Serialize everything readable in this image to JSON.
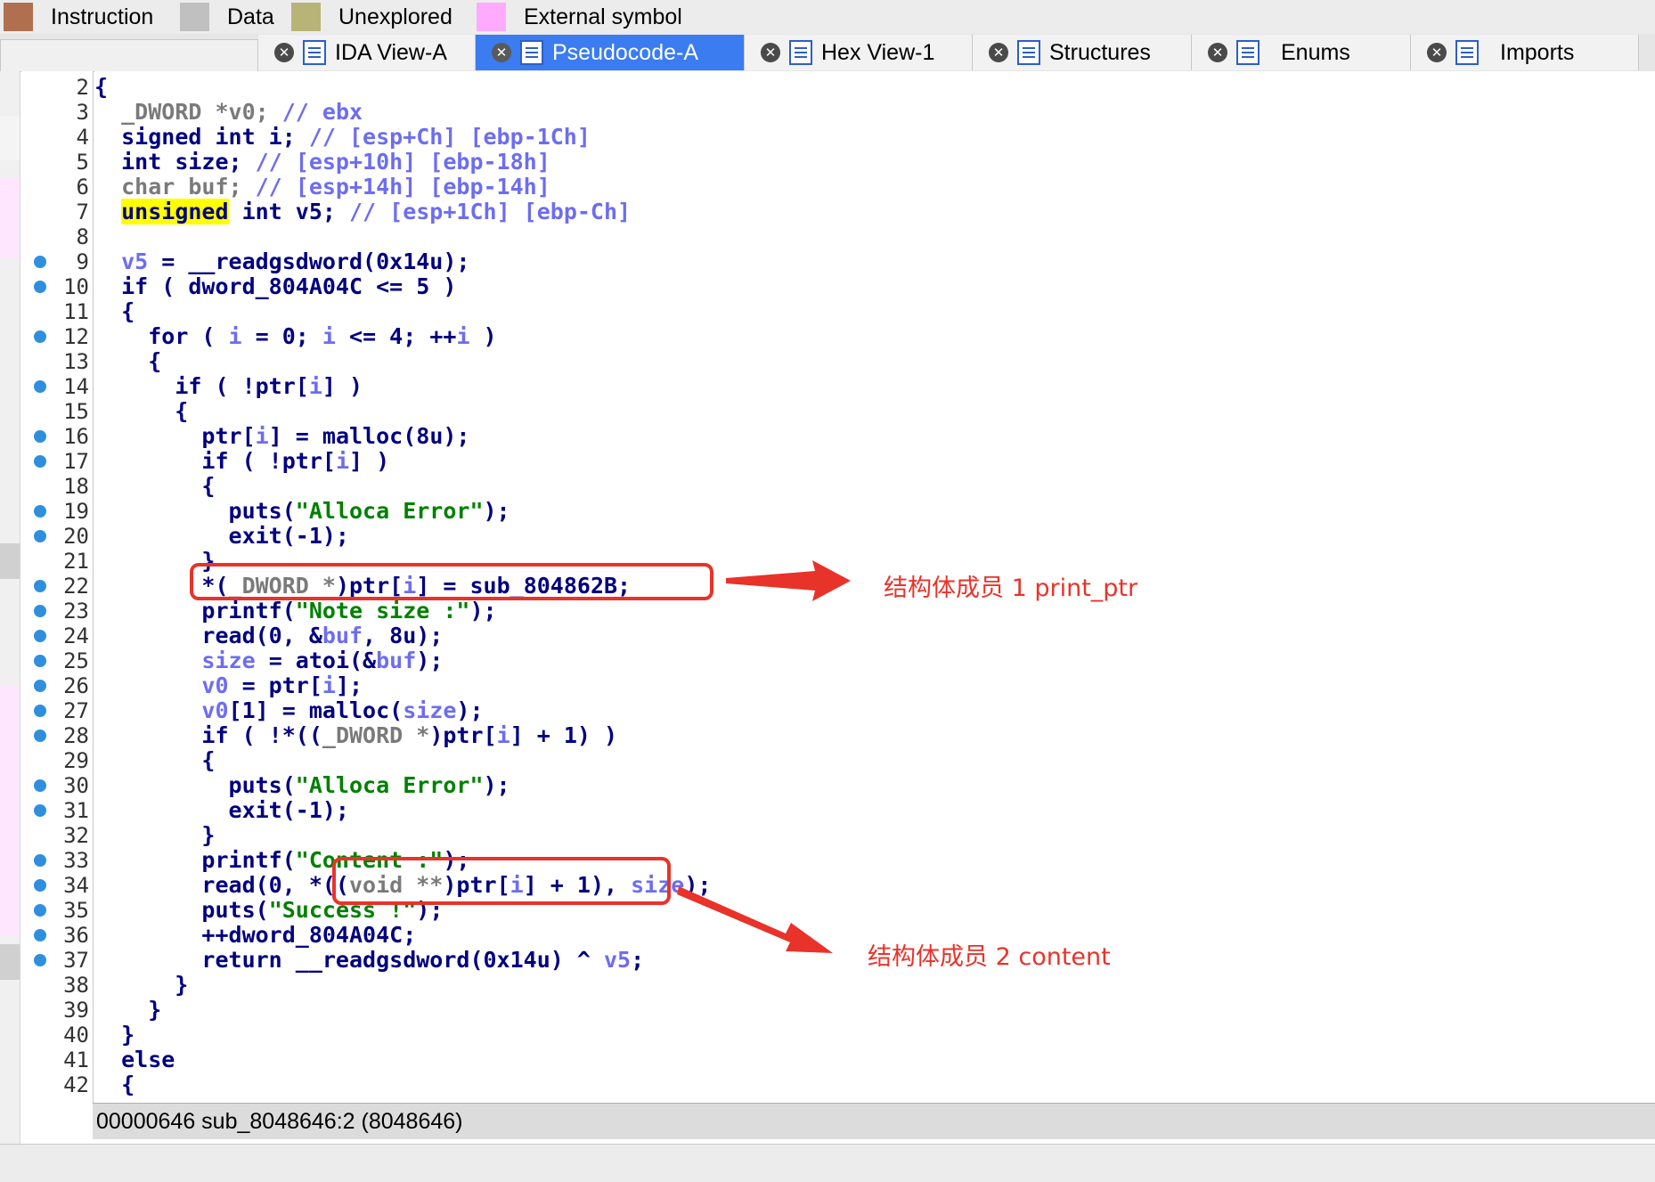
{
  "legend": [
    {
      "label": "Instruction",
      "color": "#b07050"
    },
    {
      "label": "Data",
      "color": "#c0c0c0"
    },
    {
      "label": "Unexplored",
      "color": "#b8b478"
    },
    {
      "label": "External symbol",
      "color": "#ffaaff"
    }
  ],
  "tabs": [
    {
      "label": "IDA View-A",
      "icon": "ida-view-icon",
      "active": false
    },
    {
      "label": "Pseudocode-A",
      "icon": "pseudocode-icon",
      "active": true
    },
    {
      "label": "Hex View-1",
      "icon": "hex-view-icon",
      "active": false
    },
    {
      "label": "Structures",
      "icon": "structures-icon",
      "active": false
    },
    {
      "label": "Enums",
      "icon": "enums-icon",
      "active": false
    },
    {
      "label": "Imports",
      "icon": "imports-icon",
      "active": false
    }
  ],
  "code_lines": [
    {
      "num": "2",
      "dot": false
    },
    {
      "num": "3",
      "dot": false
    },
    {
      "num": "4",
      "dot": false
    },
    {
      "num": "5",
      "dot": false
    },
    {
      "num": "6",
      "dot": false
    },
    {
      "num": "7",
      "dot": false
    },
    {
      "num": "8",
      "dot": false
    },
    {
      "num": "9",
      "dot": true
    },
    {
      "num": "10",
      "dot": true
    },
    {
      "num": "11",
      "dot": false
    },
    {
      "num": "12",
      "dot": true
    },
    {
      "num": "13",
      "dot": false
    },
    {
      "num": "14",
      "dot": true
    },
    {
      "num": "15",
      "dot": false
    },
    {
      "num": "16",
      "dot": true
    },
    {
      "num": "17",
      "dot": true
    },
    {
      "num": "18",
      "dot": false
    },
    {
      "num": "19",
      "dot": true
    },
    {
      "num": "20",
      "dot": true
    },
    {
      "num": "21",
      "dot": false
    },
    {
      "num": "22",
      "dot": true
    },
    {
      "num": "23",
      "dot": true
    },
    {
      "num": "24",
      "dot": true
    },
    {
      "num": "25",
      "dot": true
    },
    {
      "num": "26",
      "dot": true
    },
    {
      "num": "27",
      "dot": true
    },
    {
      "num": "28",
      "dot": true
    },
    {
      "num": "29",
      "dot": false
    },
    {
      "num": "30",
      "dot": true
    },
    {
      "num": "31",
      "dot": true
    },
    {
      "num": "32",
      "dot": false
    },
    {
      "num": "33",
      "dot": true
    },
    {
      "num": "34",
      "dot": true
    },
    {
      "num": "35",
      "dot": true
    },
    {
      "num": "36",
      "dot": true
    },
    {
      "num": "37",
      "dot": true
    },
    {
      "num": "38",
      "dot": false
    },
    {
      "num": "39",
      "dot": false
    },
    {
      "num": "40",
      "dot": false
    },
    {
      "num": "41",
      "dot": false
    },
    {
      "num": "42",
      "dot": false
    }
  ],
  "code": [
    [
      [
        "{",
        "tx"
      ]
    ],
    [
      [
        "  ",
        ""
      ],
      [
        "_DWORD",
        "gr"
      ],
      [
        " *v0; ",
        "gr"
      ],
      [
        "// ",
        "cm"
      ],
      [
        "ebx",
        "cm"
      ]
    ],
    [
      [
        "  ",
        ""
      ],
      [
        "signed int i; ",
        "tx"
      ],
      [
        "// ",
        "cm"
      ],
      [
        "[esp+Ch] [ebp-1Ch]",
        "cm"
      ]
    ],
    [
      [
        "  ",
        ""
      ],
      [
        "int size; ",
        "tx"
      ],
      [
        "// ",
        "cm"
      ],
      [
        "[esp+10h] [ebp-18h]",
        "cm"
      ]
    ],
    [
      [
        "  ",
        ""
      ],
      [
        "char buf; ",
        "gr"
      ],
      [
        "// ",
        "cm"
      ],
      [
        "[esp+14h] [ebp-14h]",
        "cm"
      ]
    ],
    [
      [
        "  ",
        ""
      ],
      [
        "unsigned",
        "hl"
      ],
      [
        " int v5; ",
        "tx"
      ],
      [
        "// ",
        "cm"
      ],
      [
        "[esp+1Ch] [ebp-Ch]",
        "cm"
      ]
    ],
    [
      [
        "",
        ""
      ]
    ],
    [
      [
        "  ",
        ""
      ],
      [
        "v5",
        "vr"
      ],
      [
        " = __readgsdword(0x14u);",
        "tx"
      ]
    ],
    [
      [
        "  ",
        ""
      ],
      [
        "if ( dword_804A04C <= 5 )",
        "tx"
      ]
    ],
    [
      [
        "  {",
        "tx"
      ]
    ],
    [
      [
        "    ",
        ""
      ],
      [
        "for ( ",
        "tx"
      ],
      [
        "i",
        "vr"
      ],
      [
        " = 0; ",
        "tx"
      ],
      [
        "i",
        "vr"
      ],
      [
        " <= 4; ++",
        "tx"
      ],
      [
        "i",
        "vr"
      ],
      [
        " )",
        "tx"
      ]
    ],
    [
      [
        "    {",
        "tx"
      ]
    ],
    [
      [
        "      ",
        ""
      ],
      [
        "if ( !ptr[",
        "tx"
      ],
      [
        "i",
        "vr"
      ],
      [
        "] )",
        "tx"
      ]
    ],
    [
      [
        "      {",
        "tx"
      ]
    ],
    [
      [
        "        ",
        ""
      ],
      [
        "ptr[",
        "tx"
      ],
      [
        "i",
        "vr"
      ],
      [
        "] = malloc(8u);",
        "tx"
      ]
    ],
    [
      [
        "        ",
        ""
      ],
      [
        "if ( !ptr[",
        "tx"
      ],
      [
        "i",
        "vr"
      ],
      [
        "] )",
        "tx"
      ]
    ],
    [
      [
        "        {",
        "tx"
      ]
    ],
    [
      [
        "          ",
        ""
      ],
      [
        "puts(",
        "tx"
      ],
      [
        "\"Alloca Error\"",
        "st"
      ],
      [
        ");",
        "tx"
      ]
    ],
    [
      [
        "          ",
        ""
      ],
      [
        "exit(-1);",
        "tx"
      ]
    ],
    [
      [
        "        }",
        "tx"
      ]
    ],
    [
      [
        "        ",
        ""
      ],
      [
        "*(",
        "tx"
      ],
      [
        "_DWORD *",
        "gr"
      ],
      [
        ")ptr[",
        "tx"
      ],
      [
        "i",
        "vr"
      ],
      [
        "] = sub_804862B;",
        "tx"
      ]
    ],
    [
      [
        "        ",
        ""
      ],
      [
        "printf(",
        "tx"
      ],
      [
        "\"Note size :\"",
        "st"
      ],
      [
        ");",
        "tx"
      ]
    ],
    [
      [
        "        ",
        ""
      ],
      [
        "read(0, &",
        "tx"
      ],
      [
        "buf",
        "vr"
      ],
      [
        ", 8u);",
        "tx"
      ]
    ],
    [
      [
        "        ",
        ""
      ],
      [
        "size",
        "vr"
      ],
      [
        " = atoi(&",
        "tx"
      ],
      [
        "buf",
        "vr"
      ],
      [
        ");",
        "tx"
      ]
    ],
    [
      [
        "        ",
        ""
      ],
      [
        "v0",
        "vr"
      ],
      [
        " = ptr[",
        "tx"
      ],
      [
        "i",
        "vr"
      ],
      [
        "];",
        "tx"
      ]
    ],
    [
      [
        "        ",
        ""
      ],
      [
        "v0",
        "vr"
      ],
      [
        "[1] = malloc(",
        "tx"
      ],
      [
        "size",
        "vr"
      ],
      [
        ");",
        "tx"
      ]
    ],
    [
      [
        "        ",
        ""
      ],
      [
        "if ( !*((",
        "tx"
      ],
      [
        "_DWORD *",
        "gr"
      ],
      [
        ")ptr[",
        "tx"
      ],
      [
        "i",
        "vr"
      ],
      [
        "] + 1) )",
        "tx"
      ]
    ],
    [
      [
        "        {",
        "tx"
      ]
    ],
    [
      [
        "          ",
        ""
      ],
      [
        "puts(",
        "tx"
      ],
      [
        "\"Alloca Error\"",
        "st"
      ],
      [
        ");",
        "tx"
      ]
    ],
    [
      [
        "          ",
        ""
      ],
      [
        "exit(-1);",
        "tx"
      ]
    ],
    [
      [
        "        }",
        "tx"
      ]
    ],
    [
      [
        "        ",
        ""
      ],
      [
        "printf(",
        "tx"
      ],
      [
        "\"Content :\"",
        "st"
      ],
      [
        ");",
        "tx"
      ]
    ],
    [
      [
        "        ",
        ""
      ],
      [
        "read(0, *((",
        "tx"
      ],
      [
        "void **",
        "gr"
      ],
      [
        ")ptr[",
        "tx"
      ],
      [
        "i",
        "vr"
      ],
      [
        "] + 1), ",
        "tx"
      ],
      [
        "size",
        "vr"
      ],
      [
        ");",
        "tx"
      ]
    ],
    [
      [
        "        ",
        ""
      ],
      [
        "puts(",
        "tx"
      ],
      [
        "\"Success !\"",
        "st"
      ],
      [
        ");",
        "tx"
      ]
    ],
    [
      [
        "        ",
        ""
      ],
      [
        "++dword_804A04C;",
        "tx"
      ]
    ],
    [
      [
        "        ",
        ""
      ],
      [
        "return __readgsdword(0x14u) ^ ",
        "tx"
      ],
      [
        "v5",
        "vr"
      ],
      [
        ";",
        "tx"
      ]
    ],
    [
      [
        "      }",
        "tx"
      ]
    ],
    [
      [
        "    }",
        "tx"
      ]
    ],
    [
      [
        "  }",
        "tx"
      ]
    ],
    [
      [
        "  else",
        "tx"
      ]
    ],
    [
      [
        "  {",
        "tx"
      ]
    ]
  ],
  "status": {
    "text": "00000646  sub_8048646:2 (8048646)"
  },
  "annotations": [
    {
      "text": "结构体成员 1 print_ptr"
    },
    {
      "text": "结构体成员 2 content"
    }
  ],
  "annotation_color": "#e8332a"
}
